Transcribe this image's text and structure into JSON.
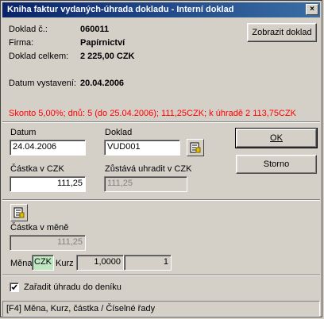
{
  "window": {
    "title": "Kniha faktur vydaných-úhrada dokladu  - Interní doklad",
    "close": "×"
  },
  "info": {
    "doc_num_label": "Doklad č.:",
    "doc_num_value": "060011",
    "firm_label": "Firma:",
    "firm_value": "Papírnictví",
    "total_label": "Doklad celkem:",
    "total_value": "2 225,00 CZK",
    "issue_label": "Datum vystavení:",
    "issue_value": "20.04.2006",
    "show_doc_button": "Zobrazit doklad",
    "discount_text": "Skonto 5,00%; dnů: 5 (do 25.04.2006);  111,25CZK; k úhradě 2 113,75CZK"
  },
  "form": {
    "date_label": "Datum",
    "date_value": "24.04.2006",
    "doc_label": "Doklad",
    "doc_value": "VUD001",
    "amount_label": "Částka v CZK",
    "amount_value": "111,25",
    "remaining_label": "Zůstává uhradit v CZK",
    "remaining_value": "111,25",
    "ok_button": "OK",
    "cancel_button": "Storno",
    "currency_amount_label": "Částka v měně",
    "currency_amount_value": "111,25",
    "currency_label": "Měna",
    "currency_value": "CZK",
    "rate_label": "Kurz",
    "rate_value": "1,0000",
    "rate_unit_value": "1",
    "journal_checkbox_label": "Zařadit úhradu do deníku",
    "journal_checked": true
  },
  "status": {
    "text": "[F4] Měna, Kurz, částka / Číselné řady"
  },
  "colors": {
    "title_start": "#0a246a",
    "title_end": "#3a6ea5",
    "discount": "#ff0000",
    "currency_bg": "#c0e8c0"
  }
}
